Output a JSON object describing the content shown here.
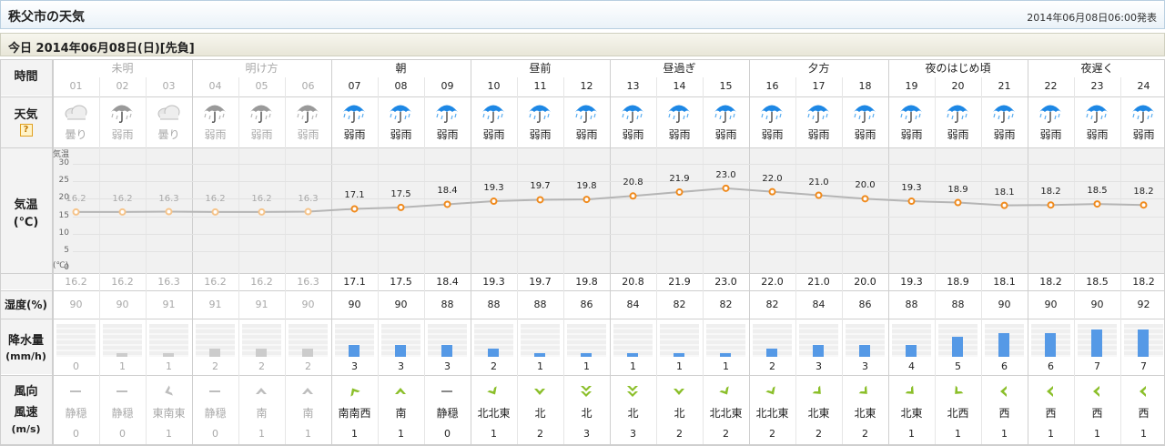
{
  "header": {
    "city": "秩父市の天気",
    "issued": "2014年06月08日06:00発表"
  },
  "date_label": "今日 2014年06月08日(日)[先負]",
  "labels": {
    "time": "時間",
    "weather": "天気",
    "weather_help": "?",
    "temp": [
      "気温",
      "(℃)"
    ],
    "humidity": "湿度(%)",
    "precip": [
      "降水量",
      "(mm/h)"
    ],
    "wind": [
      "風向",
      "風速",
      "(m/s)"
    ]
  },
  "temp_axis": {
    "top_label": "気温",
    "unit_label": "(℃)",
    "ticks": [
      "30",
      "25",
      "20",
      "15",
      "10",
      "5",
      "0"
    ]
  },
  "periods": [
    "未明",
    "明け方",
    "朝",
    "昼前",
    "昼過ぎ",
    "夕方",
    "夜のはじめ頃",
    "夜遅く"
  ],
  "hours": [
    "01",
    "02",
    "03",
    "04",
    "05",
    "06",
    "07",
    "08",
    "09",
    "10",
    "11",
    "12",
    "13",
    "14",
    "15",
    "16",
    "17",
    "18",
    "19",
    "20",
    "21",
    "22",
    "23",
    "24"
  ],
  "past_hours": 6,
  "weather": [
    {
      "icon": "cloud-icon",
      "label": "曇り"
    },
    {
      "icon": "umbrella-gray-icon",
      "label": "弱雨"
    },
    {
      "icon": "cloud-icon",
      "label": "曇り"
    },
    {
      "icon": "umbrella-gray-icon",
      "label": "弱雨"
    },
    {
      "icon": "umbrella-gray-icon",
      "label": "弱雨"
    },
    {
      "icon": "umbrella-gray-icon",
      "label": "弱雨"
    },
    {
      "icon": "umbrella-rain-icon",
      "label": "弱雨"
    },
    {
      "icon": "umbrella-rain-icon",
      "label": "弱雨"
    },
    {
      "icon": "umbrella-rain-icon",
      "label": "弱雨"
    },
    {
      "icon": "umbrella-rain-icon",
      "label": "弱雨"
    },
    {
      "icon": "umbrella-rain-icon",
      "label": "弱雨"
    },
    {
      "icon": "umbrella-rain-icon",
      "label": "弱雨"
    },
    {
      "icon": "umbrella-rain-icon",
      "label": "弱雨"
    },
    {
      "icon": "umbrella-rain-icon",
      "label": "弱雨"
    },
    {
      "icon": "umbrella-rain-icon",
      "label": "弱雨"
    },
    {
      "icon": "umbrella-rain-icon",
      "label": "弱雨"
    },
    {
      "icon": "umbrella-rain-icon",
      "label": "弱雨"
    },
    {
      "icon": "umbrella-rain-icon",
      "label": "弱雨"
    },
    {
      "icon": "umbrella-rain-icon",
      "label": "弱雨"
    },
    {
      "icon": "umbrella-rain-icon",
      "label": "弱雨"
    },
    {
      "icon": "umbrella-rain-icon",
      "label": "弱雨"
    },
    {
      "icon": "umbrella-rain-icon",
      "label": "弱雨"
    },
    {
      "icon": "umbrella-rain-icon",
      "label": "弱雨"
    },
    {
      "icon": "umbrella-rain-icon",
      "label": "弱雨"
    }
  ],
  "chart_data": {
    "type": "line",
    "x": [
      "01",
      "02",
      "03",
      "04",
      "05",
      "06",
      "07",
      "08",
      "09",
      "10",
      "11",
      "12",
      "13",
      "14",
      "15",
      "16",
      "17",
      "18",
      "19",
      "20",
      "21",
      "22",
      "23",
      "24"
    ],
    "series": [
      {
        "values": [
          16.2,
          16.2,
          16.3,
          16.2,
          16.2,
          16.3,
          17.1,
          17.5,
          18.4,
          19.3,
          19.7,
          19.8,
          20.8,
          21.9,
          23.0,
          22.0,
          21.0,
          20.0,
          19.3,
          18.9,
          18.1,
          18.2,
          18.5,
          18.2
        ]
      }
    ],
    "ylim": [
      0,
      35
    ],
    "grid": true,
    "colors": {
      "line": "#b5b5b5",
      "point_past": "#f6c48a",
      "point": "#f08a1c"
    }
  },
  "temperature": [
    "16.2",
    "16.2",
    "16.3",
    "16.2",
    "16.2",
    "16.3",
    "17.1",
    "17.5",
    "18.4",
    "19.3",
    "19.7",
    "19.8",
    "20.8",
    "21.9",
    "23.0",
    "22.0",
    "21.0",
    "20.0",
    "19.3",
    "18.9",
    "18.1",
    "18.2",
    "18.5",
    "18.2"
  ],
  "humidity": [
    "90",
    "90",
    "91",
    "91",
    "91",
    "90",
    "90",
    "90",
    "88",
    "88",
    "88",
    "86",
    "84",
    "82",
    "82",
    "82",
    "84",
    "86",
    "88",
    "88",
    "90",
    "90",
    "90",
    "92"
  ],
  "precipitation": [
    0,
    1,
    1,
    2,
    2,
    2,
    3,
    3,
    3,
    2,
    1,
    1,
    1,
    1,
    1,
    2,
    3,
    3,
    3,
    5,
    6,
    6,
    7,
    7
  ],
  "precipitation_labels": [
    "0",
    "1",
    "1",
    "2",
    "2",
    "2",
    "3",
    "3",
    "3",
    "2",
    "1",
    "1",
    "1",
    "1",
    "1",
    "2",
    "3",
    "3",
    "4",
    "5",
    "6",
    "6",
    "7",
    "7"
  ],
  "precip_scale_max": 10,
  "precip_colors": {
    "past": "#cccccc",
    "future": "#5599e6"
  },
  "wind_direction": [
    "静穏",
    "静穏",
    "東南東",
    "静穏",
    "南",
    "南",
    "南南西",
    "南",
    "静穏",
    "北北東",
    "北",
    "北",
    "北",
    "北",
    "北北東",
    "北北東",
    "北東",
    "北東",
    "北東",
    "北西",
    "西",
    "西",
    "西",
    "西"
  ],
  "wind_icon": [
    "calm-icon",
    "calm-icon",
    "arrow-ese-icon",
    "calm-icon",
    "arrow-s-icon",
    "arrow-s-icon",
    "arrow-ssw-icon",
    "arrow-s-icon",
    "calm-icon",
    "arrow-nne-icon",
    "arrow-n-icon",
    "arrow-n-double-icon",
    "arrow-n-double-icon",
    "arrow-n-icon",
    "arrow-nne-icon",
    "arrow-nne-icon",
    "arrow-ne-icon",
    "arrow-ne-icon",
    "arrow-ne-icon",
    "arrow-nw-icon",
    "arrow-w-icon",
    "arrow-w-icon",
    "arrow-w-icon",
    "arrow-w-icon"
  ],
  "wind_speed": [
    "0",
    "0",
    "1",
    "0",
    "1",
    "1",
    "1",
    "1",
    "0",
    "1",
    "2",
    "3",
    "3",
    "2",
    "2",
    "2",
    "2",
    "2",
    "1",
    "1",
    "1",
    "1",
    "1",
    "1"
  ],
  "colors": {
    "accent_blue": "#1e88e5",
    "wind_green": "#8bbf2a",
    "past_gray": "#a9a9a9"
  }
}
